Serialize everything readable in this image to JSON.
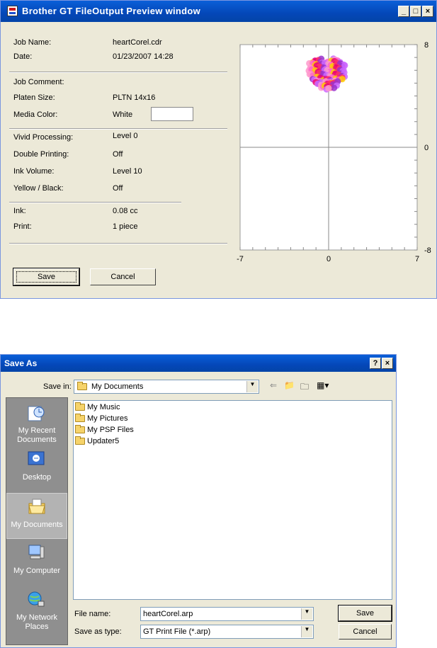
{
  "preview": {
    "title": "Brother GT FileOutput Preview window",
    "window_buttons": {
      "minimize": "_",
      "maximize": "□",
      "close": "×"
    },
    "job_name": {
      "label": "Job Name:",
      "value": "heartCorel.cdr"
    },
    "date": {
      "label": "Date:",
      "value": "01/23/2007 14:28"
    },
    "job_comment": {
      "label": "Job Comment:"
    },
    "platen_size": {
      "label": "Platen Size:",
      "value": "PLTN 14x16"
    },
    "media_color": {
      "label": "Media Color:",
      "value": "White",
      "swatch": "#ffffff"
    },
    "vivid": {
      "label": "Vivid Processing:",
      "value": "Level 0"
    },
    "double_printing": {
      "label": "Double Printing:",
      "value": "Off"
    },
    "ink_volume": {
      "label": "Ink Volume:",
      "value": "Level 10"
    },
    "yellow_black": {
      "label": "Yellow / Black:",
      "value": "Off"
    },
    "ink": {
      "label": "Ink:",
      "value": "0.08 cc"
    },
    "print": {
      "label": "Print:",
      "value": "1 piece"
    },
    "save_button": "Save",
    "cancel_button": "Cancel",
    "plot": {
      "x_range": [
        -7,
        7
      ],
      "y_range": [
        -8,
        8
      ],
      "x_tick_labels": [
        "-7",
        "0",
        "7"
      ],
      "y_tick_labels": [
        "8",
        "0",
        "-8"
      ],
      "artwork": "heart-of-dots",
      "colors": [
        "#e6007e",
        "#ff66cc",
        "#cc66ff",
        "#ff3366",
        "#ffcc00",
        "#ff99cc",
        "#9933cc"
      ]
    }
  },
  "saveas": {
    "title": "Save As",
    "title_buttons": {
      "help": "?",
      "close": "×"
    },
    "save_in_label": "Save in:",
    "save_in_value": "My Documents",
    "places": [
      {
        "label": "My Recent Documents",
        "icon": "recent-documents-icon"
      },
      {
        "label": "Desktop",
        "icon": "desktop-icon"
      },
      {
        "label": "My Documents",
        "icon": "my-documents-icon"
      },
      {
        "label": "My Computer",
        "icon": "my-computer-icon"
      },
      {
        "label": "My Network Places",
        "icon": "network-places-icon"
      }
    ],
    "files": [
      "My Music",
      "My Pictures",
      "My PSP Files",
      "Updater5"
    ],
    "file_name_label": "File name:",
    "file_name_value": "heartCorel.arp",
    "save_as_type_label": "Save as type:",
    "save_as_type_value": "GT Print File (*.arp)",
    "save_button": "Save",
    "cancel_button": "Cancel"
  }
}
